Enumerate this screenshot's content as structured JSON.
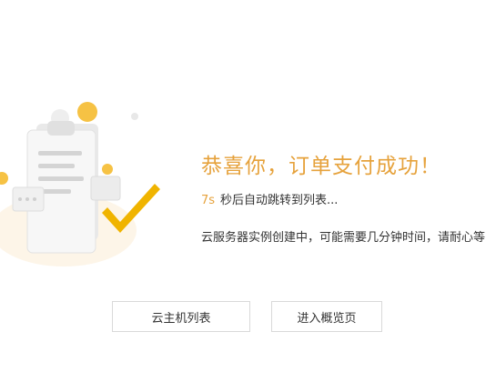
{
  "success": {
    "title": "恭喜你，订单支付成功！",
    "countdown_seconds": "7s",
    "countdown_text": "秒后自动跳转到列表...",
    "description": "云服务器实例创建中，可能需要几分钟时间，请耐心等"
  },
  "actions": {
    "instance_list_label": "云主机列表",
    "overview_label": "进入概览页"
  },
  "colors": {
    "accent": "#e6a23c",
    "check": "#f0b400",
    "text": "#333333",
    "button_border": "#d9d9d9"
  },
  "icons": [
    "document-success-illustration",
    "checkmark-icon"
  ]
}
